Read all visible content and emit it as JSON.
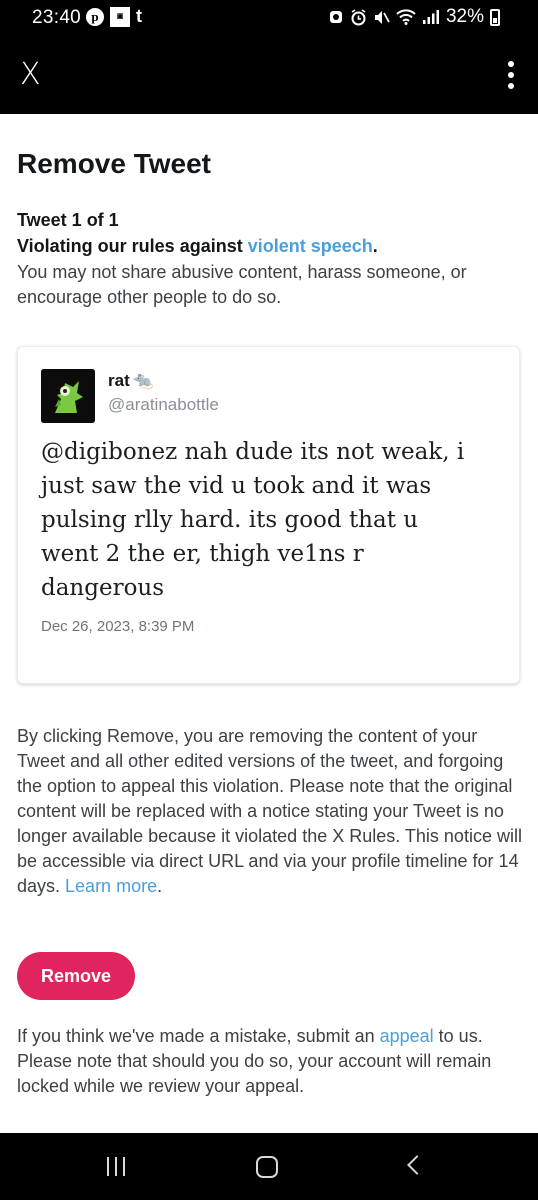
{
  "status_bar": {
    "time": "23:40",
    "battery_percent": "32%",
    "left_icons": [
      "pinterest-icon",
      "app-badge-icon",
      "tumblr-icon"
    ],
    "right_icons": [
      "sync-icon",
      "alarm-icon",
      "mute-icon",
      "wifi-icon",
      "signal-icon",
      "battery-icon"
    ]
  },
  "app_bar": {
    "close_label": "X",
    "menu_icon": "more-vertical-icon"
  },
  "page": {
    "title": "Remove Tweet",
    "tweet_count": "Tweet 1 of 1",
    "violation_prefix": "Violating our rules against ",
    "violation_link": "violent speech",
    "violation_suffix": ".",
    "violation_description": "You may not share abusive content, harass someone, or encourage other people to do so."
  },
  "tweet": {
    "display_name": "rat",
    "name_emoji": "🐀",
    "handle": "@aratinabottle",
    "text": "@digibonez nah dude its not weak, i just saw the vid u took and it was pulsing rlly hard. its good that u went 2 the er, thigh ve1ns r dangerous",
    "date": "Dec 26, 2023, 8:39 PM"
  },
  "removal_info": {
    "text": "By clicking Remove, you are removing the content of your Tweet and all other edited versions of the tweet, and forgoing the option to appeal this violation. Please note that the original content will be replaced with a notice stating your Tweet is no longer available because it violated the X Rules. This notice will be accessible via direct URL and via your profile timeline for 14 days. ",
    "link": "Learn more",
    "suffix": "."
  },
  "remove_button": {
    "label": "Remove",
    "color": "#e0245e"
  },
  "appeal_info": {
    "prefix": "If you think we've made a mistake, submit an ",
    "link": "appeal",
    "suffix": " to us. Please note that should you do so, your account will remain locked while we review your appeal."
  },
  "nav_bar": {
    "icons": [
      "recent-apps-icon",
      "home-icon",
      "back-icon"
    ]
  },
  "colors": {
    "link": "#4a9fdb",
    "remove": "#e0245e",
    "bars": "#000000"
  }
}
